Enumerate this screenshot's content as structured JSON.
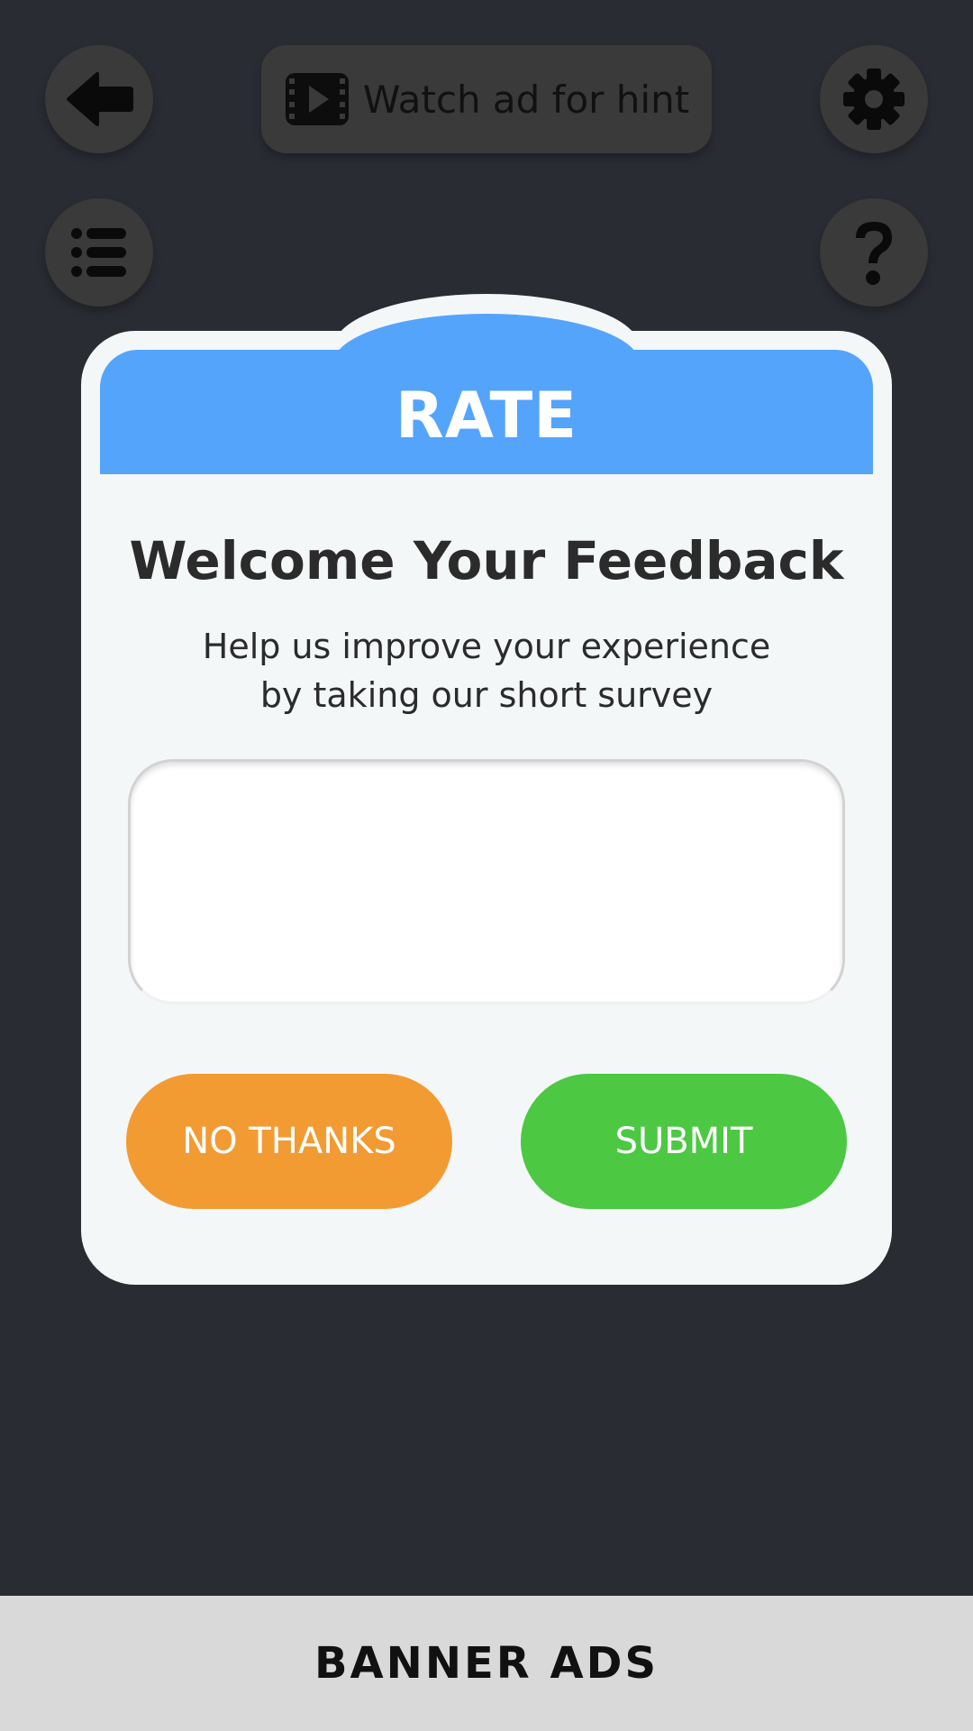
{
  "top_bar": {
    "hint_button_label": "Watch ad for hint"
  },
  "dialog": {
    "title": "RATE",
    "heading": "Welcome Your Feedback",
    "subtext_line1": "Help us improve your experience",
    "subtext_line2": "by taking our short survey",
    "feedback_value": "",
    "no_thanks_label": "NO THANKS",
    "submit_label": "SUBMIT"
  },
  "banner": {
    "label": "BANNER ADS"
  },
  "colors": {
    "background": "#2a2c34",
    "header_blue": "#54a4fc",
    "no_thanks_orange": "#f29b33",
    "submit_green": "#4cc843",
    "dialog_bg": "#f4f7f8"
  },
  "icons": {
    "back": "arrow-left-icon",
    "hint": "video-play-icon",
    "settings": "gear-icon",
    "menu": "list-icon",
    "help": "question-mark-icon"
  }
}
